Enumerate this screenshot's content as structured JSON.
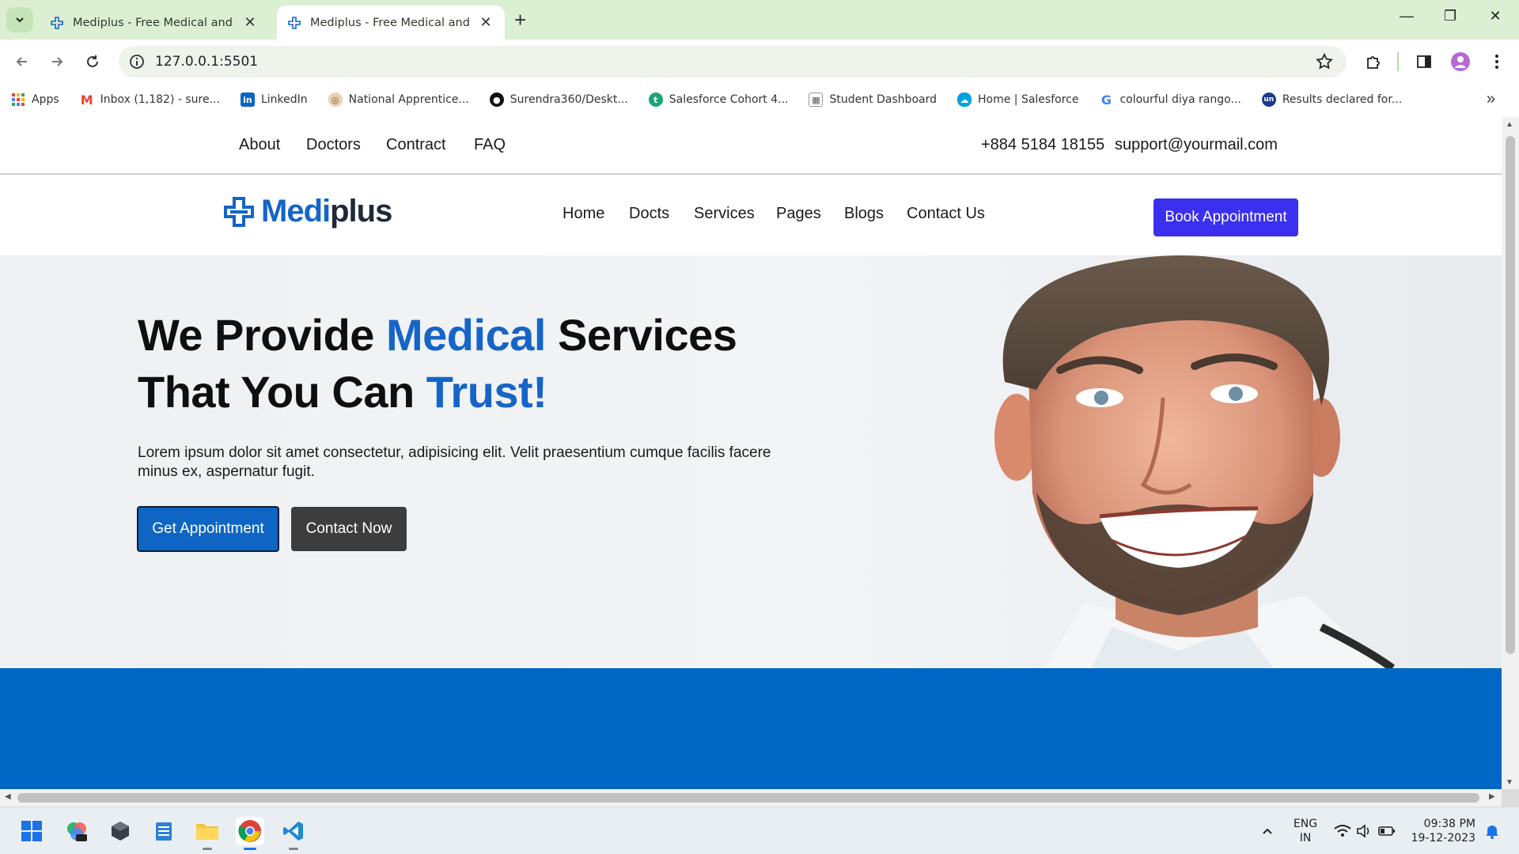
{
  "browser": {
    "tabs": [
      {
        "title": "Mediplus - Free Medical and Do",
        "active": false
      },
      {
        "title": "Mediplus - Free Medical and Do",
        "active": true
      }
    ],
    "url": "127.0.0.1:5501",
    "bookmarks": [
      {
        "label": "Apps",
        "icon": "apps-grid-icon"
      },
      {
        "label": "Inbox (1,182) - sure...",
        "icon": "gmail-icon"
      },
      {
        "label": "LinkedIn",
        "icon": "linkedin-icon"
      },
      {
        "label": "National Apprentice...",
        "icon": "emblem-icon"
      },
      {
        "label": "Surendra360/Deskt...",
        "icon": "github-icon"
      },
      {
        "label": "Salesforce Cohort 4...",
        "icon": "salesforce-trail-icon"
      },
      {
        "label": "Student Dashboard",
        "icon": "dashboard-icon"
      },
      {
        "label": "Home | Salesforce",
        "icon": "salesforce-cloud-icon"
      },
      {
        "label": "colourful diya rango...",
        "icon": "google-icon"
      },
      {
        "label": "Results declared for...",
        "icon": "un-icon"
      }
    ]
  },
  "page": {
    "topbar": {
      "links": [
        "About",
        "Doctors",
        "Contract",
        "FAQ"
      ],
      "phone": "+884 5184 18155",
      "email": "support@yourmail.com"
    },
    "logo": {
      "part1": "Medi",
      "part2": "plus"
    },
    "nav": [
      "Home",
      "Docts",
      "Services",
      "Pages",
      "Blogs",
      "Contact Us"
    ],
    "book_button": "Book Appointment",
    "hero": {
      "line1_a": "We Provide ",
      "line1_accent": "Medical",
      "line1_b": " Services",
      "line2_a": "That You Can ",
      "line2_accent": "Trust!",
      "description": "Lorem ipsum dolor sit amet consectetur, adipisicing elit. Velit praesentium cumque facilis facere minus ex, aspernatur fugit.",
      "primary_button": "Get Appointment",
      "secondary_button": "Contact Now"
    },
    "colors": {
      "accent": "#1564c8",
      "book": "#3b2ff0",
      "band": "#0067c5"
    }
  },
  "taskbar": {
    "lang_line1": "ENG",
    "lang_line2": "IN",
    "time": "09:38 PM",
    "date": "19-12-2023"
  }
}
